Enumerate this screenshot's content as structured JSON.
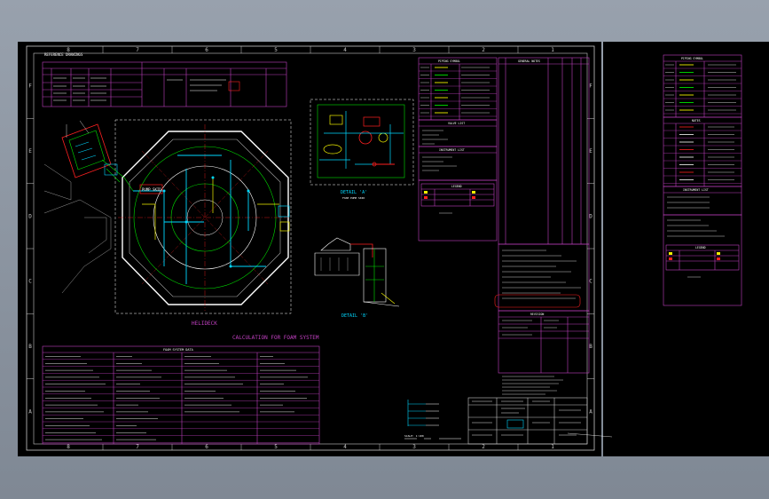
{
  "colors": {
    "bg": "#000000",
    "frame": "#c8c8c8",
    "magenta": "#c040c0",
    "cyan": "#00d8ff",
    "green": "#00e000",
    "yellow": "#f0f000",
    "red": "#ff2020",
    "white": "#ffffff"
  },
  "border": {
    "columns": [
      "8",
      "7",
      "6",
      "5",
      "4",
      "3",
      "2",
      "1"
    ],
    "rows": [
      "F",
      "E",
      "D",
      "C",
      "B",
      "A"
    ]
  },
  "header_label": "REFERENCE DRAWINGS",
  "plan": {
    "title": "HELIDECK",
    "pump_label": "PUMP SKID"
  },
  "detail_a": {
    "title": "DETAIL 'A'",
    "sub": "FOAM PUMP SKID"
  },
  "detail_b": {
    "title": "DETAIL 'B'"
  },
  "calc_title": "CALCULATION FOR FOAM SYSTEM",
  "panel_titles": {
    "main_notes": "GENERAL NOTES",
    "piping": "PIPING SYMBOL",
    "valves": "VALVE LIST",
    "instruments": "INSTRUMENT LIST",
    "legend": "LEGEND",
    "revision": "REVISION",
    "side_sym": "PIPING SYMBOL",
    "side_notes": "NOTES",
    "side_inst": "INSTRUMENT LIST",
    "side_legend": "LEGEND"
  },
  "table_heading": "FOAM SYSTEM DATA",
  "scale_label": "SCALE: 1:100"
}
